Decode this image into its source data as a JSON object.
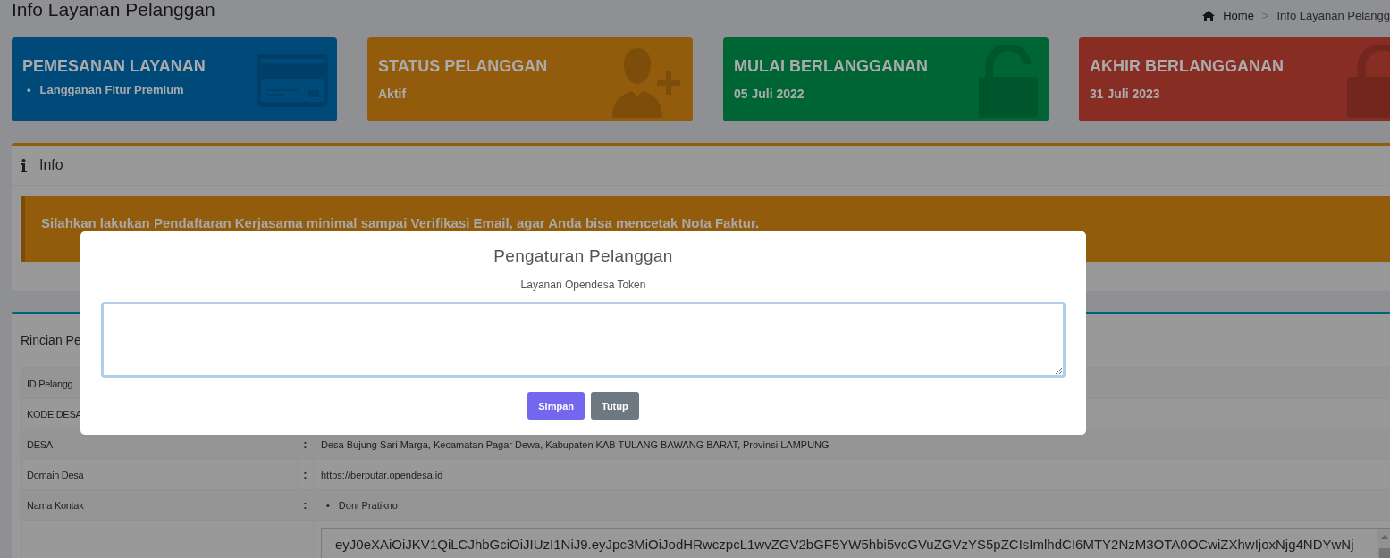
{
  "page": {
    "title": "Info Layanan Pelanggan"
  },
  "breadcrumb": {
    "home": "Home",
    "separator": ">",
    "current": "Info Layanan Pelangg"
  },
  "cards": [
    {
      "title": "PEMESANAN LAYANAN",
      "kind": "list",
      "color": "#004a7a",
      "bullet": "•",
      "items": [
        "Langganan Fitur Premium"
      ]
    },
    {
      "title": "STATUS PELANGGAN",
      "kind": "value",
      "color": "#935c0c",
      "value": "Aktif"
    },
    {
      "title": "MULAI BERLANGGANAN",
      "kind": "value",
      "color": "#006534",
      "value": "05 Juli 2022"
    },
    {
      "title": "AKHIR BERLANGGANAN",
      "kind": "value",
      "color": "#872d24",
      "value": "31 Juli 2023"
    }
  ],
  "info_box": {
    "title": "Info",
    "alert": "Silahkan lakukan Pendaftaran Kerjasama minimal sampai Verifikasi Email, agar Anda bisa mencetak Nota Faktur."
  },
  "details": {
    "title": "Rincian Pe",
    "rows": [
      {
        "label": "ID Pelangg",
        "kind": "text"
      },
      {
        "label": "KODE DESA",
        "kind": "text"
      },
      {
        "label": "DESA",
        "separator": ":",
        "kind": "text",
        "value": "Desa Bujung Sari Marga, Kecamatan Pagar Dewa, Kabupaten KAB TULANG BAWANG BARAT, Provinsi LAMPUNG"
      },
      {
        "label": "Domain Desa",
        "separator": ":",
        "kind": "text",
        "value": "https://berputar.opendesa.id"
      },
      {
        "label": "Nama Kontak",
        "separator": ":",
        "kind": "list",
        "bullet": "•",
        "items": [
          "Doni Pratikno"
        ]
      },
      {
        "kind": "token",
        "value": "eyJ0eXAiOiJKV1QiLCJhbGciOiJIUzI1NiJ9.eyJpc3MiOiJodHRwczpcL1wvZGV2bGF5YW5hbi5vcGVuZGVzYS5pZCIsImlhdCI6MTY2NzM3OTA0OCwiZXhwIjoxNjg4NDYwNj"
      }
    ]
  },
  "modal": {
    "title": "Pengaturan Pelanggan",
    "subtitle": "Layanan Opendesa Token",
    "field": {
      "focused": true
    },
    "buttons": [
      {
        "label": "Simpan",
        "kind": "primary"
      },
      {
        "label": "Tutup",
        "kind": "secondary"
      }
    ]
  }
}
